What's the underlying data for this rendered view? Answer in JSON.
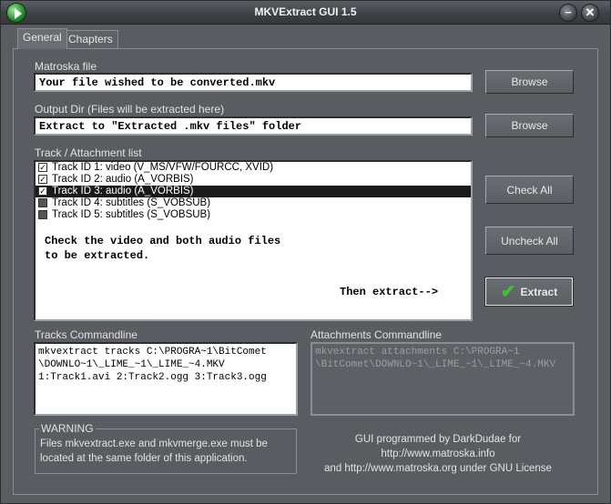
{
  "window": {
    "title": "MKVExtract GUI 1.5",
    "minimize_glyph": "−",
    "close_glyph": "✕"
  },
  "tabs": [
    {
      "label": "General",
      "active": true
    },
    {
      "label": "Chapters",
      "active": false
    }
  ],
  "matroska": {
    "label": "Matroska file",
    "value": "Your file wished to be converted.mkv",
    "browse_label": "Browse"
  },
  "output": {
    "label": "Output Dir (Files will be extracted here)",
    "value": "Extract to \"Extracted .mkv files\" folder",
    "browse_label": "Browse"
  },
  "tracks": {
    "label": "Track / Attachment list",
    "items": [
      {
        "label": "Track ID 1: video (V_MS/VFW/FOURCC, XVID)",
        "checked": true,
        "selected": false
      },
      {
        "label": "Track ID 2: audio (A_VORBIS)",
        "checked": true,
        "selected": false
      },
      {
        "label": "Track ID 3: audio (A_VORBIS)",
        "checked": true,
        "selected": true
      },
      {
        "label": "Track ID 4: subtitles (S_VOBSUB)",
        "checked": false,
        "selected": false
      },
      {
        "label": "Track ID 5: subtitles (S_VOBSUB)",
        "checked": false,
        "selected": false
      }
    ],
    "note_line1": "Check the video and both audio files",
    "note_line2": "to be extracted.",
    "note_extract": "Then extract-->"
  },
  "buttons": {
    "check_all": "Check All",
    "uncheck_all": "Uncheck All",
    "extract": "Extract"
  },
  "tracks_cmd": {
    "label": "Tracks Commandline",
    "value": "mkvextract tracks C:\\PROGRA~1\\BitComet\n\\DOWNLO~1\\_LIME_~1\\_LIME_~4.MKV\n1:Track1.avi 2:Track2.ogg 3:Track3.ogg"
  },
  "attach_cmd": {
    "label": "Attachments Commandline",
    "value": "mkvextract attachments C:\\PROGRA~1\n\\BitComet\\DOWNLO~1\\_LIME_~1\\_LIME_~4.MKV"
  },
  "warning": {
    "title": "WARNING",
    "text": "Files mkvextract.exe and mkvmerge.exe must be located at the same folder of this application."
  },
  "credits": {
    "line1": "GUI programmed by DarkDudae for http://www.matroska.info",
    "line2": "and http://www.matroska.org under GNU License"
  }
}
